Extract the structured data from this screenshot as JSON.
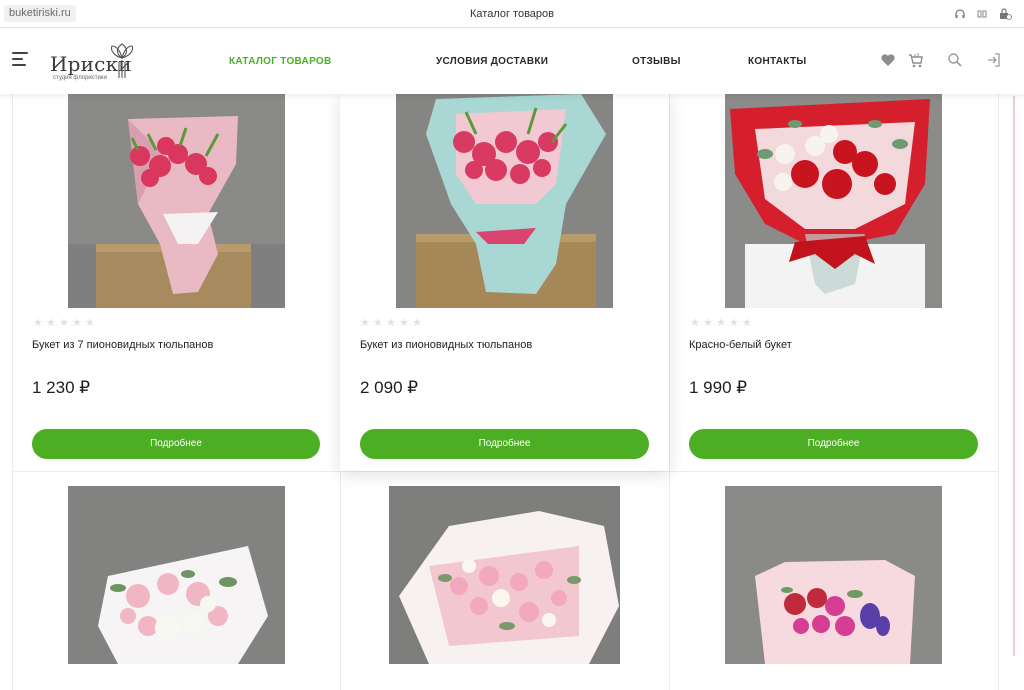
{
  "browser": {
    "url": "buketiriski.ru",
    "tab_title": "Каталог товаров"
  },
  "header": {
    "logo_name": "Ириски",
    "logo_tagline": "студия флористики",
    "nav": [
      {
        "label": "КАТАЛОГ ТОВАРОВ",
        "active": true
      },
      {
        "label": "УСЛОВИЯ ДОСТАВКИ",
        "active": false
      },
      {
        "label": "ОТЗЫВЫ",
        "active": false
      },
      {
        "label": "КОНТАКТЫ",
        "active": false
      }
    ],
    "icons": [
      "heart-icon",
      "cart-icon",
      "search-icon",
      "login-icon"
    ]
  },
  "products": [
    {
      "name": "Букет из 7 пионовидных тюльпанов",
      "price": "1 230 ₽",
      "rating": 0,
      "button": "Подробнее"
    },
    {
      "name": "Букет из пионовидных тюльпанов",
      "price": "2 090 ₽",
      "rating": 0,
      "button": "Подробнее"
    },
    {
      "name": "Красно-белый букет",
      "price": "1 990 ₽",
      "rating": 0,
      "button": "Подробнее"
    }
  ],
  "colors": {
    "accent": "#4cae22",
    "nav_active": "#4caf26"
  }
}
